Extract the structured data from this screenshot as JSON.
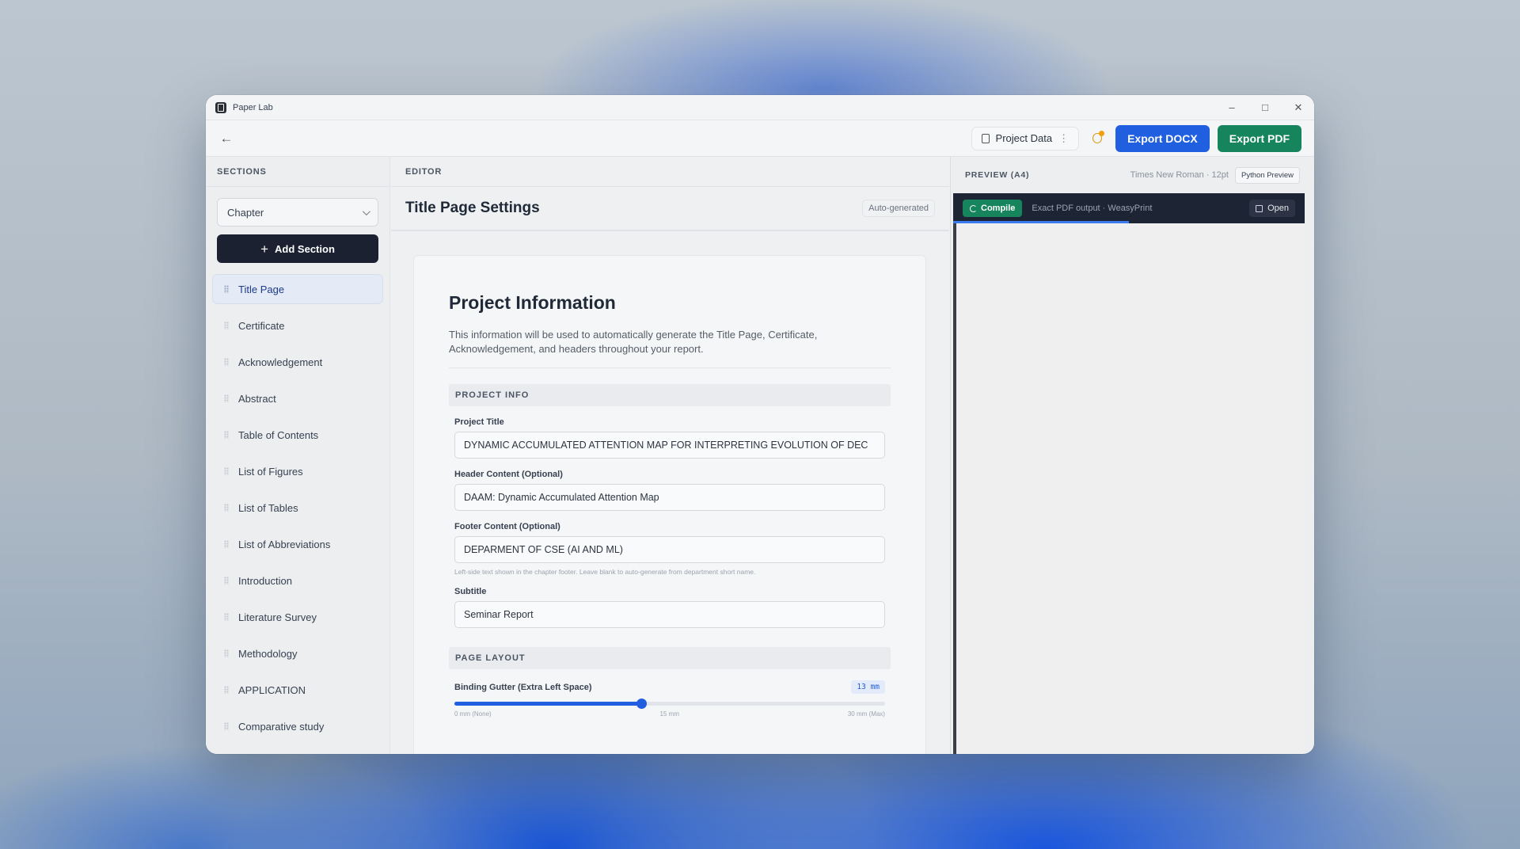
{
  "app": {
    "title": "Paper Lab"
  },
  "toolbar": {
    "project_data_label": "Project Data",
    "export_docx_label": "Export DOCX",
    "export_pdf_label": "Export PDF"
  },
  "sidebar": {
    "heading": "SECTIONS",
    "section_type_selected": "Chapter",
    "add_section_label": "Add Section",
    "items": [
      {
        "label": "Title Page"
      },
      {
        "label": "Certificate"
      },
      {
        "label": "Acknowledgement"
      },
      {
        "label": "Abstract"
      },
      {
        "label": "Table of Contents"
      },
      {
        "label": "List of Figures"
      },
      {
        "label": "List of Tables"
      },
      {
        "label": "List of Abbreviations"
      },
      {
        "label": "Introduction"
      },
      {
        "label": "Literature Survey"
      },
      {
        "label": "Methodology"
      },
      {
        "label": "APPLICATION"
      },
      {
        "label": "Comparative study"
      }
    ],
    "active_index": 0
  },
  "editor": {
    "heading": "EDITOR",
    "title": "Title Page Settings",
    "badge": "Auto-generated",
    "card_title": "Project Information",
    "description": "This information will be used to automatically generate the Title Page, Certificate, Acknowledgement, and headers throughout your report.",
    "project_info_heading": "PROJECT INFO",
    "fields": {
      "project_title": {
        "label": "Project Title",
        "value": "DYNAMIC ACCUMULATED ATTENTION MAP FOR INTERPRETING EVOLUTION OF DEC"
      },
      "header_content": {
        "label": "Header Content (Optional)",
        "value": "DAAM: Dynamic Accumulated Attention Map"
      },
      "footer_content": {
        "label": "Footer Content (Optional)",
        "value": "DEPARMENT OF CSE (AI AND ML)",
        "hint": "Left-side text shown in the chapter footer. Leave blank to auto-generate from department short name."
      },
      "subtitle": {
        "label": "Subtitle",
        "value": "Seminar Report"
      }
    },
    "page_layout_heading": "PAGE LAYOUT",
    "binding_gutter": {
      "label": "Binding Gutter (Extra Left Space)",
      "value_text": "13 mm",
      "value_mm": 13,
      "min_mm": 0,
      "max_mm": 30,
      "tick_min": "0 mm (None)",
      "tick_mid": "15 mm",
      "tick_max": "30 mm (Max)"
    }
  },
  "preview": {
    "heading": "PREVIEW (A4)",
    "font_info": "Times New Roman · 12pt",
    "python_preview_label": "Python Preview",
    "compile_label": "Compile",
    "output_info": "Exact PDF output · WeasyPrint",
    "open_label": "Open",
    "progress": 0.5
  },
  "colors": {
    "accent_blue": "#1f5fe0",
    "accent_green": "#16855d",
    "dark_button": "#1b2130"
  }
}
